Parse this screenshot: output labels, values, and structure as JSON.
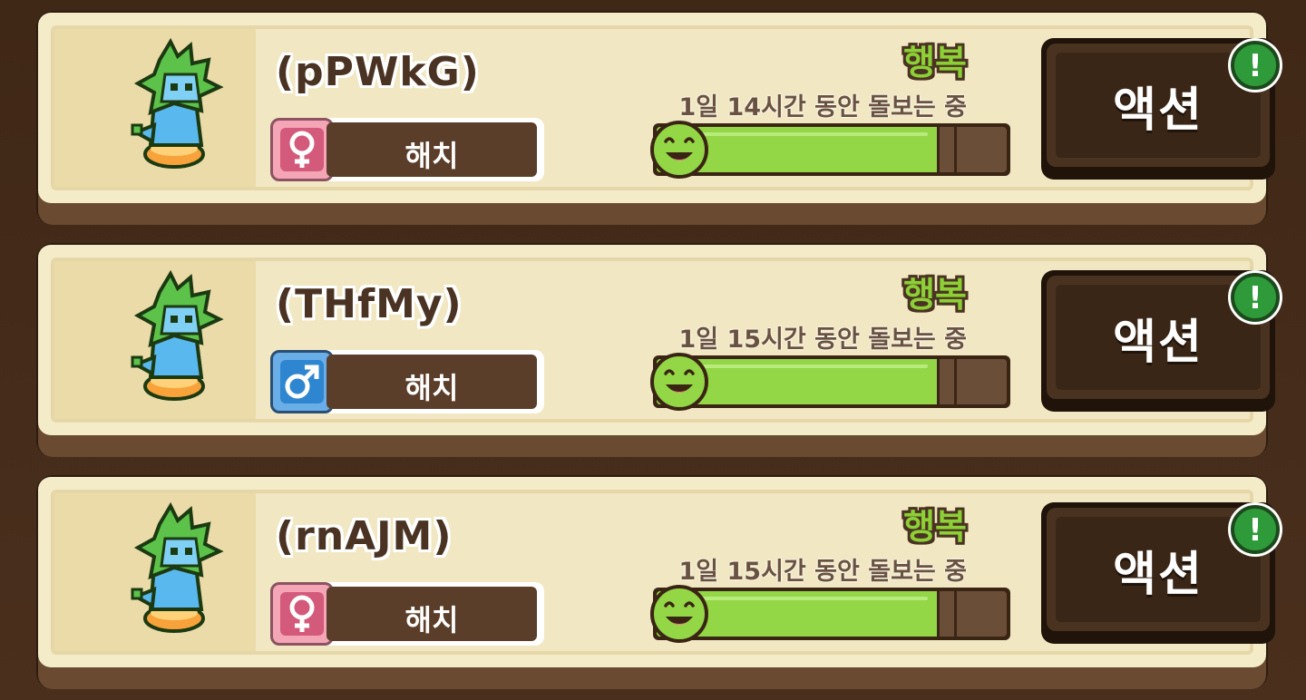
{
  "pets": [
    {
      "name": "(pPWkG)",
      "gender": "female",
      "stage": "해치",
      "happy_label": "행복",
      "care_text": "1일 14시간 동안 돌보는 중",
      "happiness": 0.8,
      "action_label": "액션",
      "alert": "!"
    },
    {
      "name": "(THfMy)",
      "gender": "male",
      "stage": "해치",
      "happy_label": "행복",
      "care_text": "1일 15시간 동안 돌보는 중",
      "happiness": 0.8,
      "action_label": "액션",
      "alert": "!"
    },
    {
      "name": "(rnAJM)",
      "gender": "female",
      "stage": "해치",
      "happy_label": "행복",
      "care_text": "1일 15시간 동안 돌보는 중",
      "happiness": 0.8,
      "action_label": "액션",
      "alert": "!"
    }
  ],
  "colors": {
    "happy_green": "#93d646",
    "female_pink": "#d35a7a",
    "male_blue": "#2f86d0",
    "alert_green": "#2f9a3a"
  }
}
